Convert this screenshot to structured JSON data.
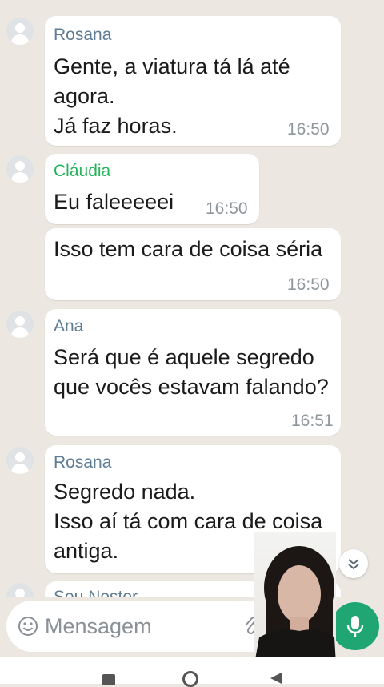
{
  "messages": [
    {
      "sender": "Rosana",
      "sender_color": "#5e7c94",
      "text": "Gente, a viatura tá lá até\nagora.\nJá faz horas.",
      "time": "16:50"
    },
    {
      "sender": "Cláudia",
      "sender_color": "#26b35b",
      "text": "Eu faleeeeei",
      "time": "16:50"
    },
    {
      "sender": "",
      "text": "Isso tem cara de coisa séria",
      "time": "16:50"
    },
    {
      "sender": "Ana",
      "sender_color": "#5e7c94",
      "text": "Será que é aquele segredo\nque vocês estavam falando?",
      "time": "16:51"
    },
    {
      "sender": "Rosana",
      "sender_color": "#5e7c94",
      "text": "Segredo nada.\nIsso aí tá com cara de coisa\nantiga.",
      "time": ""
    },
    {
      "sender": "Seu Nestor",
      "sender_color": "#5e7c94",
      "text": "",
      "time": ""
    }
  ],
  "composer": {
    "placeholder": "Mensagem"
  },
  "icons": {
    "emoji": "emoji-icon",
    "attach": "paperclip-icon",
    "mic": "microphone-icon",
    "scroll": "chevron-double-down-icon",
    "avatar": "default-avatar-icon"
  },
  "colors": {
    "background": "#ece8e1",
    "mic_button": "#1fa672",
    "bubble": "#ffffff"
  }
}
